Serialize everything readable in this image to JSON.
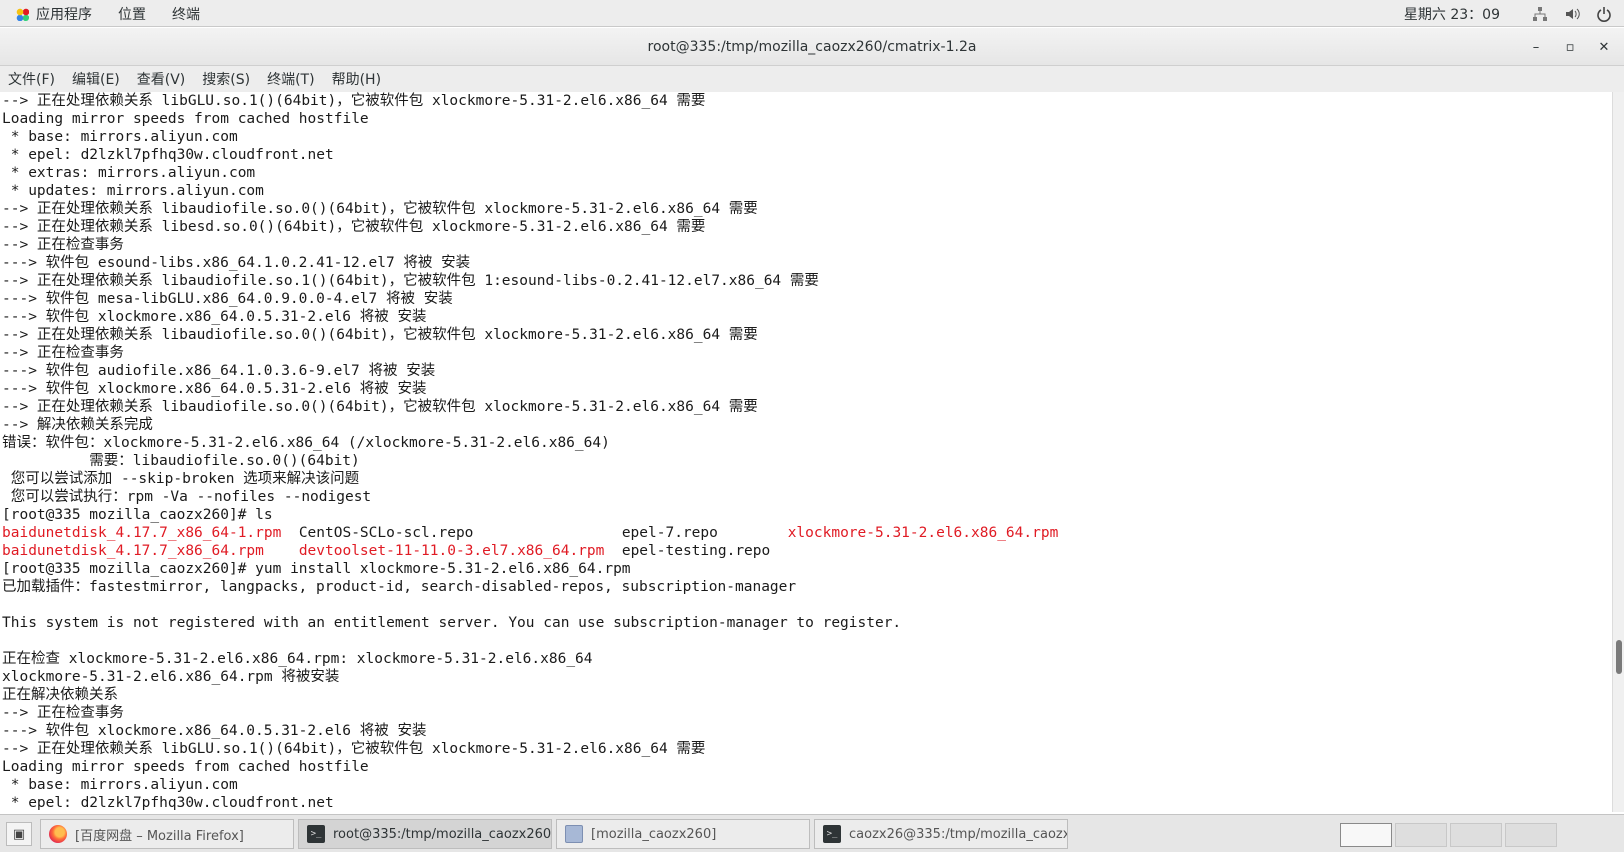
{
  "top_panel": {
    "applications": "应用程序",
    "places": "位置",
    "terminal_app": "终端",
    "clock": "星期六 23：09",
    "icons": [
      "network-icon",
      "volume-icon",
      "power-icon"
    ]
  },
  "window": {
    "title": "root@335:/tmp/mozilla_caozx260/cmatrix-1.2a",
    "minimize": "–",
    "maximize": "▫",
    "close": "✕"
  },
  "menubar": {
    "items": [
      "文件(F)",
      "编辑(E)",
      "查看(V)",
      "搜索(S)",
      "终端(T)",
      "帮助(H)"
    ]
  },
  "terminal": {
    "lines": [
      "--> 正在处理依赖关系 libGLU.so.1()(64bit)，它被软件包 xlockmore-5.31-2.el6.x86_64 需要",
      "Loading mirror speeds from cached hostfile",
      " * base: mirrors.aliyun.com",
      " * epel: d2lzkl7pfhq30w.cloudfront.net",
      " * extras: mirrors.aliyun.com",
      " * updates: mirrors.aliyun.com",
      "--> 正在处理依赖关系 libaudiofile.so.0()(64bit)，它被软件包 xlockmore-5.31-2.el6.x86_64 需要",
      "--> 正在处理依赖关系 libesd.so.0()(64bit)，它被软件包 xlockmore-5.31-2.el6.x86_64 需要",
      "--> 正在检查事务",
      "---> 软件包 esound-libs.x86_64.1.0.2.41-12.el7 将被 安装",
      "--> 正在处理依赖关系 libaudiofile.so.1()(64bit)，它被软件包 1:esound-libs-0.2.41-12.el7.x86_64 需要",
      "---> 软件包 mesa-libGLU.x86_64.0.9.0.0-4.el7 将被 安装",
      "---> 软件包 xlockmore.x86_64.0.5.31-2.el6 将被 安装",
      "--> 正在处理依赖关系 libaudiofile.so.0()(64bit)，它被软件包 xlockmore-5.31-2.el6.x86_64 需要",
      "--> 正在检查事务",
      "---> 软件包 audiofile.x86_64.1.0.3.6-9.el7 将被 安装",
      "---> 软件包 xlockmore.x86_64.0.5.31-2.el6 将被 安装",
      "--> 正在处理依赖关系 libaudiofile.so.0()(64bit)，它被软件包 xlockmore-5.31-2.el6.x86_64 需要",
      "--> 解决依赖关系完成",
      "错误：软件包：xlockmore-5.31-2.el6.x86_64 (/xlockmore-5.31-2.el6.x86_64)",
      "          需要：libaudiofile.so.0()(64bit)",
      " 您可以尝试添加 --skip-broken 选项来解决该问题",
      " 您可以尝试执行：rpm -Va --nofiles --nodigest",
      "[root@335 mozilla_caozx260]# ls"
    ],
    "ls_row1": {
      "a": "baidunetdisk_4.17.7_x86_64-1.rpm",
      "b": "  CentOS-SCLo-scl.repo                 epel-7.repo        ",
      "c": "xlockmore-5.31-2.el6.x86_64.rpm"
    },
    "ls_row2": {
      "a": "baidunetdisk_4.17.7_x86_64.rpm",
      "b": "    ",
      "c": "devtoolset-11-11.0-3.el7.x86_64.rpm",
      "d": "  epel-testing.repo"
    },
    "lines_after": [
      "[root@335 mozilla_caozx260]# yum install xlockmore-5.31-2.el6.x86_64.rpm",
      "已加载插件：fastestmirror, langpacks, product-id, search-disabled-repos, subscription-manager",
      "",
      "This system is not registered with an entitlement server. You can use subscription-manager to register.",
      "",
      "正在检查 xlockmore-5.31-2.el6.x86_64.rpm: xlockmore-5.31-2.el6.x86_64",
      "xlockmore-5.31-2.el6.x86_64.rpm 将被安装",
      "正在解决依赖关系",
      "--> 正在检查事务",
      "---> 软件包 xlockmore.x86_64.0.5.31-2.el6 将被 安装",
      "--> 正在处理依赖关系 libGLU.so.1()(64bit)，它被软件包 xlockmore-5.31-2.el6.x86_64 需要",
      "Loading mirror speeds from cached hostfile",
      " * base: mirrors.aliyun.com",
      " * epel: d2lzkl7pfhq30w.cloudfront.net"
    ]
  },
  "taskbar": {
    "tasks": [
      "[百度网盘 – Mozilla Firefox]",
      "root@335:/tmp/mozilla_caozx260/…",
      "[mozilla_caozx260]",
      "caozx26@335:/tmp/mozilla_caozx…"
    ]
  },
  "colors": {
    "red_file": "#e01b24"
  }
}
